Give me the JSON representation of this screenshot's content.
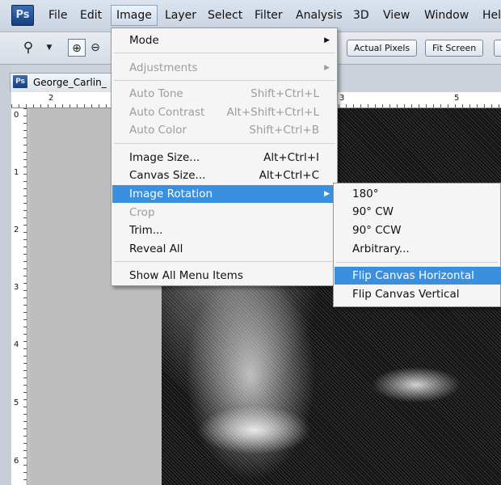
{
  "app": {
    "logo": "Ps"
  },
  "menubar": {
    "items": [
      "File",
      "Edit",
      "Image",
      "Layer",
      "Select",
      "Filter",
      "Analysis",
      "3D",
      "View",
      "Window",
      "Hel"
    ],
    "active": "Image"
  },
  "options_bar": {
    "actual_pixels": "Actual Pixels",
    "fit_screen": "Fit Screen"
  },
  "document": {
    "tab_label": "George_Carlin_",
    "tab_icon": "Ps"
  },
  "rulers": {
    "h_labels": [
      "2",
      "3",
      "5"
    ],
    "v_labels": [
      "0",
      "1",
      "2",
      "3",
      "4",
      "5",
      "6"
    ]
  },
  "image_menu": {
    "mode": "Mode",
    "adjustments": "Adjustments",
    "auto_tone": {
      "label": "Auto Tone",
      "shortcut": "Shift+Ctrl+L"
    },
    "auto_contrast": {
      "label": "Auto Contrast",
      "shortcut": "Alt+Shift+Ctrl+L"
    },
    "auto_color": {
      "label": "Auto Color",
      "shortcut": "Shift+Ctrl+B"
    },
    "image_size": {
      "label": "Image Size...",
      "shortcut": "Alt+Ctrl+I"
    },
    "canvas_size": {
      "label": "Canvas Size...",
      "shortcut": "Alt+Ctrl+C"
    },
    "image_rotation": "Image Rotation",
    "crop": "Crop",
    "trim": "Trim...",
    "reveal_all": "Reveal All",
    "show_all": "Show All Menu Items"
  },
  "rotation_submenu": {
    "r180": "180°",
    "cw": "90° CW",
    "ccw": "90° CCW",
    "arbitrary": "Arbitrary...",
    "flip_h": "Flip Canvas Horizontal",
    "flip_v": "Flip Canvas Vertical"
  },
  "colors": {
    "highlight": "#3b8fdf",
    "disabled": "#9c9c9c"
  }
}
